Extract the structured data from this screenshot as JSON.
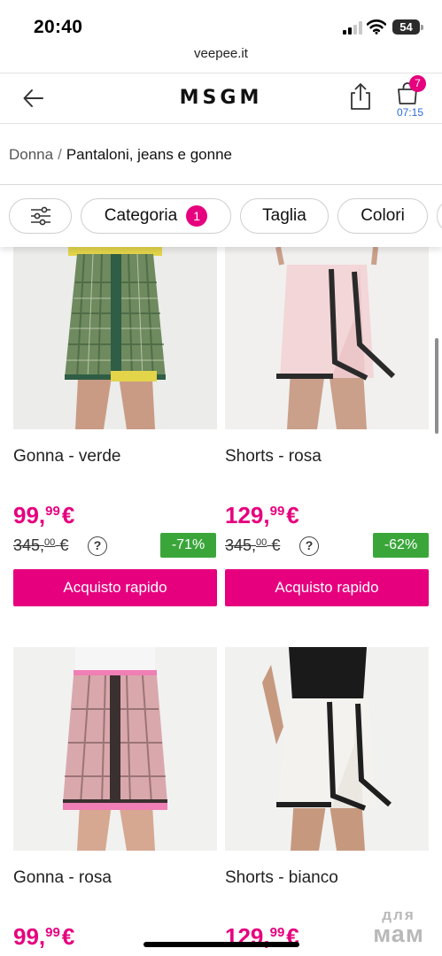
{
  "status_bar": {
    "time": "20:40",
    "battery": "54"
  },
  "url": "veepee.it",
  "header": {
    "brand": "MSGM",
    "cart_count": "7",
    "cart_timer": "07:15"
  },
  "breadcrumb": {
    "parent": "Donna",
    "separator": "/",
    "current": "Pantaloni, jeans e gonne"
  },
  "filters": {
    "categoria": "Categoria",
    "categoria_badge": "1",
    "taglia": "Taglia",
    "colori": "Colori"
  },
  "products": [
    {
      "name": "Gonna - verde",
      "price_int": "99,",
      "price_dec": "99",
      "price_cur": "€",
      "old_int": "345,",
      "old_dec": "00",
      "old_cur": "€",
      "discount": "-71%",
      "cta": "Acquisto rapido",
      "colors": {
        "primary": "#6e8a5e",
        "accent": "#e3d44a"
      }
    },
    {
      "name": "Shorts - rosa",
      "price_int": "129,",
      "price_dec": "99",
      "price_cur": "€",
      "old_int": "345,",
      "old_dec": "00",
      "old_cur": "€",
      "discount": "-62%",
      "cta": "Acquisto rapido",
      "colors": {
        "primary": "#f3d6d8",
        "accent": "#2a2a2a"
      }
    },
    {
      "name": "Gonna - rosa",
      "price_int": "99,",
      "price_dec": "99",
      "price_cur": "€",
      "colors": {
        "primary": "#d9a8ad",
        "accent": "#ef7fb4"
      }
    },
    {
      "name": "Shorts - bianco",
      "price_int": "129,",
      "price_dec": "99",
      "price_cur": "€",
      "colors": {
        "primary": "#f4f2ee",
        "accent": "#1f1f1f"
      }
    }
  ],
  "watermark": {
    "top": "для",
    "bottom": "мам"
  },
  "theme": {
    "accent": "#e6007e",
    "discount_green": "#3aa63a",
    "link_blue": "#2d6ad9"
  }
}
